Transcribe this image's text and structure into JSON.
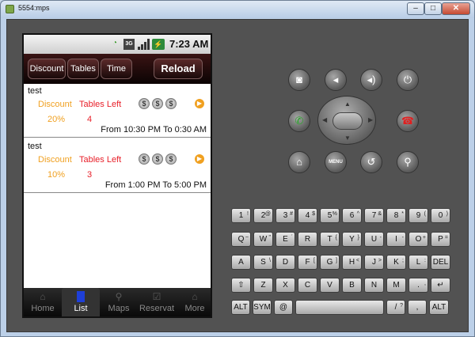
{
  "window": {
    "title": "5554:mps",
    "min": "–",
    "max": "□",
    "close": "✕"
  },
  "status": {
    "time": "7:23 AM",
    "network": "3G",
    "battery": "⚡"
  },
  "toolbar": {
    "discount": "Discount",
    "tables": "Tables",
    "time": "Time",
    "reload": "Reload"
  },
  "list": [
    {
      "name": "test",
      "discount_label": "Discount",
      "tables_label": "Tables Left",
      "discount": "20%",
      "tables": "4",
      "price": [
        "$",
        "$",
        "$"
      ],
      "time_range": "From 10:30 PM To 0:30 AM"
    },
    {
      "name": "test",
      "discount_label": "Discount",
      "tables_label": "Tables Left",
      "discount": "10%",
      "tables": "3",
      "price": [
        "$",
        "$",
        "$"
      ],
      "time_range": "From 1:00 PM To 5:00 PM"
    }
  ],
  "tabs": [
    {
      "label": "Home",
      "icon": "home-icon"
    },
    {
      "label": "List",
      "icon": "list-icon",
      "selected": true
    },
    {
      "label": "Maps",
      "icon": "map-pin-icon"
    },
    {
      "label": "Reservat",
      "icon": "reservation-icon"
    },
    {
      "label": "More",
      "icon": "more-icon"
    }
  ],
  "hardware": {
    "menu": "MENU"
  },
  "keyboard": {
    "row1": [
      {
        "k": "1",
        "a": "!"
      },
      {
        "k": "2",
        "a": "@"
      },
      {
        "k": "3",
        "a": "#"
      },
      {
        "k": "4",
        "a": "$"
      },
      {
        "k": "5",
        "a": "%"
      },
      {
        "k": "6",
        "a": "^"
      },
      {
        "k": "7",
        "a": "&"
      },
      {
        "k": "8",
        "a": "*"
      },
      {
        "k": "9",
        "a": "("
      },
      {
        "k": "0",
        "a": ")"
      }
    ],
    "row2": [
      {
        "k": "Q",
        "a": "~"
      },
      {
        "k": "W",
        "a": "\""
      },
      {
        "k": "E",
        "a": "´"
      },
      {
        "k": "R",
        "a": ""
      },
      {
        "k": "T",
        "a": "{"
      },
      {
        "k": "Y",
        "a": "}"
      },
      {
        "k": "U",
        "a": "-"
      },
      {
        "k": "I",
        "a": "-"
      },
      {
        "k": "O",
        "a": "+"
      },
      {
        "k": "P",
        "a": "="
      }
    ],
    "row3": [
      {
        "k": "A",
        "a": ""
      },
      {
        "k": "S",
        "a": "\\"
      },
      {
        "k": "D",
        "a": ""
      },
      {
        "k": "F",
        "a": "["
      },
      {
        "k": "G",
        "a": "]"
      },
      {
        "k": "H",
        "a": "<"
      },
      {
        "k": "J",
        "a": ">"
      },
      {
        "k": "K",
        "a": ";"
      },
      {
        "k": "L",
        "a": ":"
      },
      {
        "k": "DEL",
        "a": ""
      }
    ],
    "row4": [
      {
        "k": "⇧",
        "a": ""
      },
      {
        "k": "Z",
        "a": ""
      },
      {
        "k": "X",
        "a": ""
      },
      {
        "k": "C",
        "a": ""
      },
      {
        "k": "V",
        "a": ""
      },
      {
        "k": "B",
        "a": ""
      },
      {
        "k": "N",
        "a": ""
      },
      {
        "k": "M",
        "a": ""
      },
      {
        "k": ".",
        "a": ","
      },
      {
        "k": "↵",
        "a": ""
      }
    ],
    "row5": [
      {
        "k": "ALT",
        "a": ""
      },
      {
        "k": "SYM",
        "a": ""
      },
      {
        "k": "@",
        "a": ""
      },
      {
        "k": "",
        "a": ""
      },
      {
        "k": "/",
        "a": "?"
      },
      {
        "k": ",",
        "a": ""
      },
      {
        "k": "ALT",
        "a": ""
      }
    ]
  }
}
